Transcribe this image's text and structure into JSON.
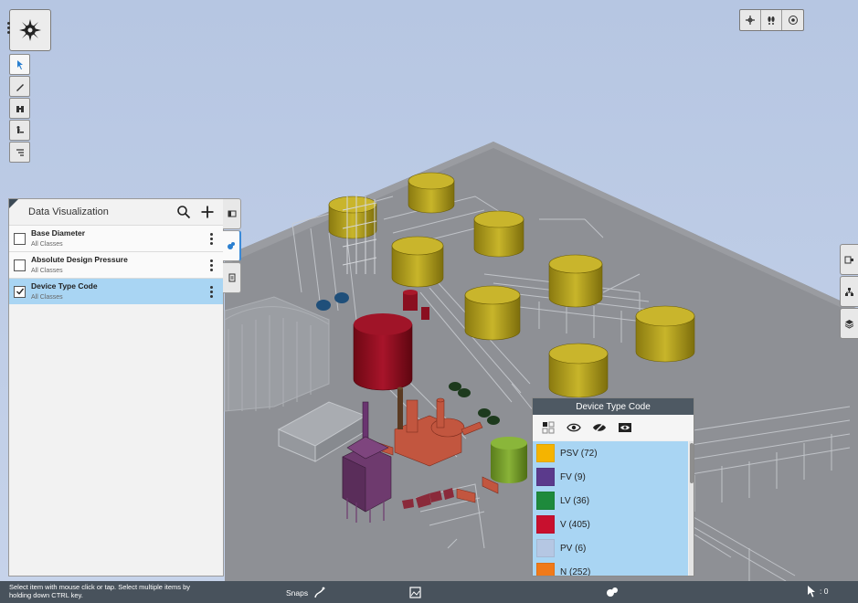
{
  "data_panel": {
    "title": "Data Visualization",
    "items": [
      {
        "name": "Base Diameter",
        "sub": "All Classes",
        "checked": false
      },
      {
        "name": "Absolute Design Pressure",
        "sub": "All Classes",
        "checked": false
      },
      {
        "name": "Device Type Code",
        "sub": "All Classes",
        "checked": true
      }
    ]
  },
  "legend": {
    "title": "Device Type Code",
    "entries": [
      {
        "label": "PSV (72)",
        "color": "#f5b400"
      },
      {
        "label": "FV (9)",
        "color": "#5b3a8c"
      },
      {
        "label": "LV (36)",
        "color": "#1e8a3c"
      },
      {
        "label": "V (405)",
        "color": "#c8102e"
      },
      {
        "label": "PV (6)",
        "color": "#b5c7e3"
      },
      {
        "label": "N (252)",
        "color": "#f07a1a"
      }
    ]
  },
  "status": {
    "hint": "Select item with mouse click or tap. Select multiple items by holding down CTRL key.",
    "snaps_label": "Snaps",
    "selection_count": ": 0"
  },
  "icons": {
    "main_tool": "gear-compass-icon",
    "left_tools": [
      "select-arrow-icon",
      "measure-icon",
      "binoculars-icon",
      "person-walk-icon",
      "list-filter-icon"
    ],
    "top_right": [
      "crosshair-icon",
      "footprints-icon",
      "view-cube-icon"
    ],
    "right_tools": [
      "tag-icon",
      "hierarchy-icon",
      "layers-icon"
    ]
  }
}
